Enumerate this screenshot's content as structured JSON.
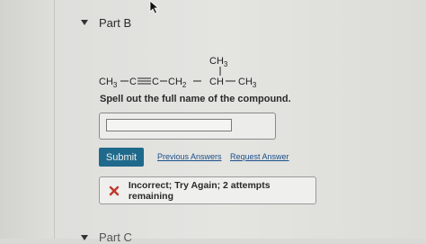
{
  "part_b": {
    "title": "Part B"
  },
  "structure": {
    "top_group": "CH3",
    "main_chain_left": "CH3",
    "c1": "C",
    "c2": "C",
    "ch2": "CH2",
    "ch": "CH",
    "main_chain_right": "CH3"
  },
  "question": {
    "prompt": "Spell out the full name of the compound."
  },
  "answer": {
    "value": "",
    "placeholder": ""
  },
  "actions": {
    "submit_label": "Submit",
    "previous_answers_label": "Previous Answers",
    "request_answer_label": "Request Answer"
  },
  "feedback": {
    "message": "Incorrect; Try Again; 2 attempts remaining",
    "icon": "x-icon",
    "color": "#c0392b"
  },
  "part_c": {
    "title": "Part C"
  },
  "colors": {
    "submit_bg": "#1f6a8c",
    "link": "#1b4f8a"
  }
}
